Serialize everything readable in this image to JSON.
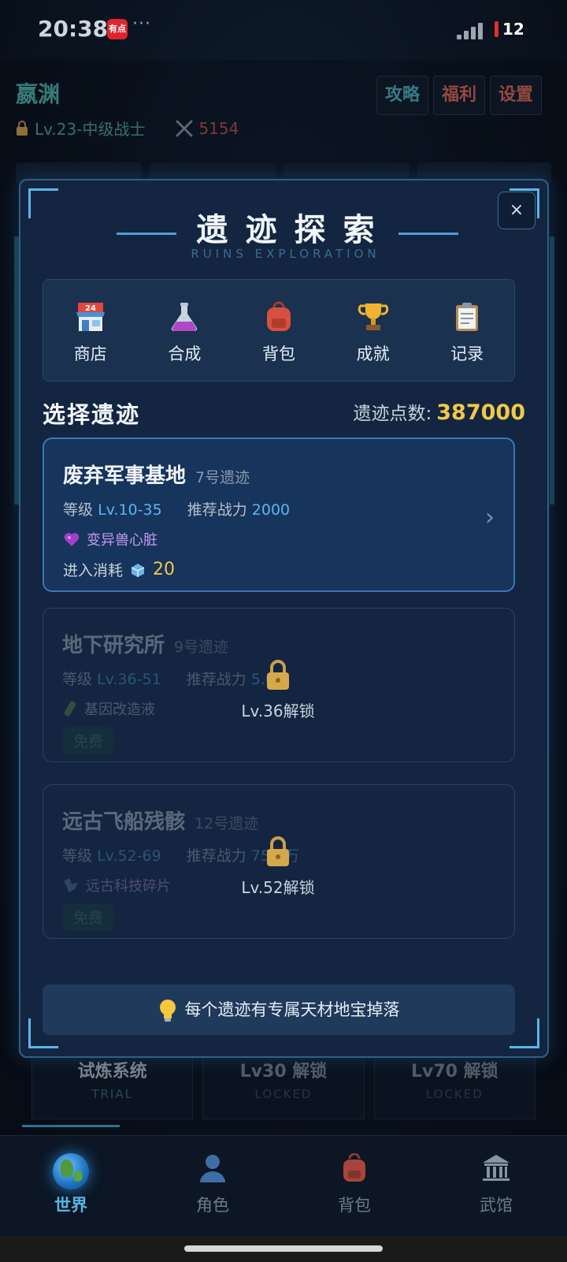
{
  "status_bar": {
    "time": "20:38",
    "app_badge": "有点",
    "more": "···",
    "battery": "12"
  },
  "player": {
    "name": "嬴渊",
    "level": "Lv.23-中级战士",
    "power": "5154"
  },
  "top_buttons": [
    {
      "label": "攻略",
      "color": "#4fb8c8"
    },
    {
      "label": "福利",
      "color": "#e06a5a"
    },
    {
      "label": "设置",
      "color": "#e06a5a"
    }
  ],
  "modal": {
    "title": "遗迹探索",
    "subtitle": "RUINS EXPLORATION",
    "close": "×",
    "menu": [
      {
        "label": "商店",
        "icon": "store-icon"
      },
      {
        "label": "合成",
        "icon": "flask-icon"
      },
      {
        "label": "背包",
        "icon": "backpack-icon"
      },
      {
        "label": "成就",
        "icon": "trophy-icon"
      },
      {
        "label": "记录",
        "icon": "clipboard-icon"
      }
    ],
    "section_title": "选择遗迹",
    "points_label": "遗迹点数:",
    "points_value": "387000",
    "ruins": [
      {
        "name": "废弃军事基地",
        "number": "7号遗迹",
        "level_label": "等级",
        "level": "Lv.10-35",
        "power_label": "推荐战力",
        "power": "2000",
        "drop": "变异兽心脏",
        "drop_icon": "heart-icon",
        "cost_label": "进入消耗",
        "cost": "20",
        "cost_icon": "ice-crystal-icon",
        "locked": false
      },
      {
        "name": "地下研究所",
        "number": "9号遗迹",
        "level_label": "等级",
        "level": "Lv.36-51",
        "power_label": "推荐战力",
        "power": "5.0万",
        "drop": "基因改造液",
        "drop_icon": "vial-icon",
        "free_label": "免费",
        "locked": true,
        "unlock_text": "Lv.36解锁"
      },
      {
        "name": "远古飞船残骸",
        "number": "12号遗迹",
        "level_label": "等级",
        "level": "Lv.52-69",
        "power_label": "推荐战力",
        "power": "75.0万",
        "drop": "远古科技碎片",
        "drop_icon": "tech-fragment-icon",
        "free_label": "免费",
        "locked": true,
        "unlock_text": "Lv.52解锁"
      }
    ],
    "tip": "每个遗迹有专属天材地宝掉落"
  },
  "bottom_cards": [
    {
      "title": "试炼系统",
      "sub": "TRIAL"
    },
    {
      "title": "Lv30 解锁",
      "sub": "LOCKED"
    },
    {
      "title": "Lv70 解锁",
      "sub": "LOCKED"
    }
  ],
  "tabs": [
    {
      "label": "世界",
      "icon": "globe-icon",
      "active": true
    },
    {
      "label": "角色",
      "icon": "person-icon",
      "active": false
    },
    {
      "label": "背包",
      "icon": "backpack-icon",
      "active": false
    },
    {
      "label": "武馆",
      "icon": "dojo-icon",
      "active": false
    }
  ]
}
